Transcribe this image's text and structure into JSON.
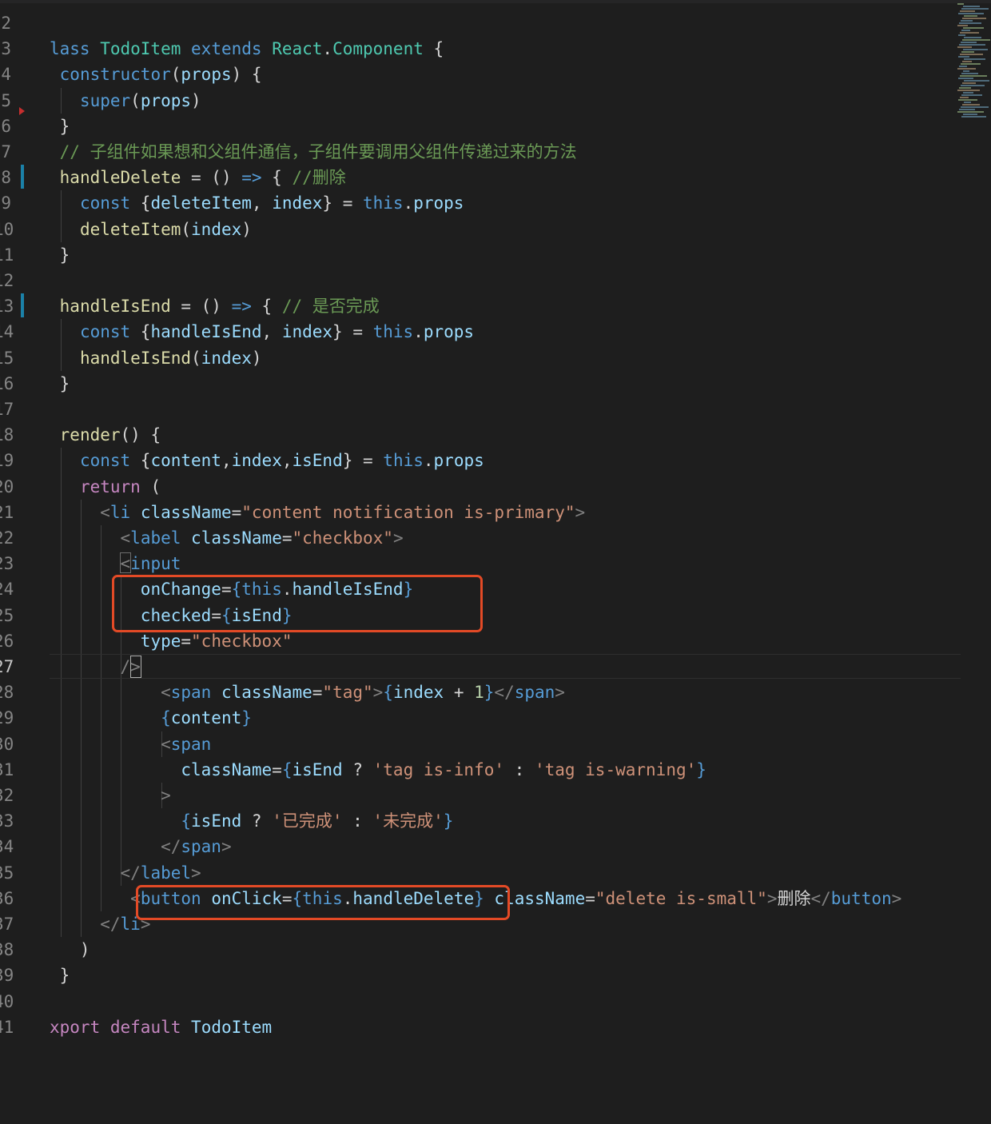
{
  "colors": {
    "background": "#1e1e1e",
    "keyword": "#569cd6",
    "control": "#c586c0",
    "class_name": "#4ec9b0",
    "function_name": "#dcdcaa",
    "variable": "#9cdcfe",
    "string": "#ce9178",
    "comment": "#6a9955",
    "number": "#b5cea8",
    "plain": "#d4d4d4",
    "tag_punct": "#808080",
    "highlight_annotation": "#e34a26"
  },
  "editor": {
    "line_numbers": [
      "2",
      "3",
      "4",
      "5",
      "6",
      "7",
      "8",
      "9",
      "10",
      "11",
      "12",
      "13",
      "14",
      "15",
      "16",
      "17",
      "18",
      "19",
      "20",
      "21",
      "22",
      "23",
      "24",
      "25",
      "26",
      "27",
      "28",
      "29",
      "30",
      "31",
      "32",
      "33",
      "34",
      "35",
      "36",
      "37",
      "38",
      "39",
      "40",
      "41"
    ],
    "active_line": "27",
    "modified_lines": [
      "8",
      "13"
    ],
    "lines": [
      {
        "n": "2",
        "tokens": []
      },
      {
        "n": "3",
        "tokens": [
          {
            "t": "lass ",
            "c": "keyword"
          },
          {
            "t": "TodoItem",
            "c": "class_name"
          },
          {
            "t": " ",
            "c": "plain"
          },
          {
            "t": "extends",
            "c": "keyword"
          },
          {
            "t": " ",
            "c": "plain"
          },
          {
            "t": "React",
            "c": "class_name"
          },
          {
            "t": ".",
            "c": "plain"
          },
          {
            "t": "Component",
            "c": "class_name"
          },
          {
            "t": " {",
            "c": "plain"
          }
        ]
      },
      {
        "n": "4",
        "tokens": [
          {
            "t": " ",
            "c": "plain"
          },
          {
            "t": "constructor",
            "c": "keyword"
          },
          {
            "t": "(",
            "c": "plain"
          },
          {
            "t": "props",
            "c": "variable"
          },
          {
            "t": ") {",
            "c": "plain"
          }
        ]
      },
      {
        "n": "5",
        "tokens": [
          {
            "t": "   ",
            "c": "plain"
          },
          {
            "t": "super",
            "c": "keyword"
          },
          {
            "t": "(",
            "c": "plain"
          },
          {
            "t": "props",
            "c": "variable"
          },
          {
            "t": ")",
            "c": "plain"
          }
        ]
      },
      {
        "n": "6",
        "tokens": [
          {
            "t": " }",
            "c": "plain"
          }
        ]
      },
      {
        "n": "7",
        "tokens": [
          {
            "t": " // 子组件如果想和父组件通信，子组件要调用父组件传递过来的方法",
            "c": "comment"
          }
        ]
      },
      {
        "n": "8",
        "tokens": [
          {
            "t": " ",
            "c": "plain"
          },
          {
            "t": "handleDelete",
            "c": "function_name"
          },
          {
            "t": " = () ",
            "c": "plain"
          },
          {
            "t": "=>",
            "c": "keyword"
          },
          {
            "t": " { ",
            "c": "plain"
          },
          {
            "t": "//删除",
            "c": "comment"
          }
        ]
      },
      {
        "n": "9",
        "tokens": [
          {
            "t": "   ",
            "c": "plain"
          },
          {
            "t": "const",
            "c": "keyword"
          },
          {
            "t": " {",
            "c": "plain"
          },
          {
            "t": "deleteItem",
            "c": "variable"
          },
          {
            "t": ", ",
            "c": "plain"
          },
          {
            "t": "index",
            "c": "variable"
          },
          {
            "t": "} = ",
            "c": "plain"
          },
          {
            "t": "this",
            "c": "keyword"
          },
          {
            "t": ".",
            "c": "plain"
          },
          {
            "t": "props",
            "c": "variable"
          }
        ]
      },
      {
        "n": "10",
        "tokens": [
          {
            "t": "   ",
            "c": "plain"
          },
          {
            "t": "deleteItem",
            "c": "function_name"
          },
          {
            "t": "(",
            "c": "plain"
          },
          {
            "t": "index",
            "c": "variable"
          },
          {
            "t": ")",
            "c": "plain"
          }
        ]
      },
      {
        "n": "11",
        "tokens": [
          {
            "t": " }",
            "c": "plain"
          }
        ]
      },
      {
        "n": "12",
        "tokens": []
      },
      {
        "n": "13",
        "tokens": [
          {
            "t": " ",
            "c": "plain"
          },
          {
            "t": "handleIsEnd",
            "c": "function_name"
          },
          {
            "t": " = () ",
            "c": "plain"
          },
          {
            "t": "=>",
            "c": "keyword"
          },
          {
            "t": " { ",
            "c": "plain"
          },
          {
            "t": "// 是否完成",
            "c": "comment"
          }
        ]
      },
      {
        "n": "14",
        "tokens": [
          {
            "t": "   ",
            "c": "plain"
          },
          {
            "t": "const",
            "c": "keyword"
          },
          {
            "t": " {",
            "c": "plain"
          },
          {
            "t": "handleIsEnd",
            "c": "variable"
          },
          {
            "t": ", ",
            "c": "plain"
          },
          {
            "t": "index",
            "c": "variable"
          },
          {
            "t": "} = ",
            "c": "plain"
          },
          {
            "t": "this",
            "c": "keyword"
          },
          {
            "t": ".",
            "c": "plain"
          },
          {
            "t": "props",
            "c": "variable"
          }
        ]
      },
      {
        "n": "15",
        "tokens": [
          {
            "t": "   ",
            "c": "plain"
          },
          {
            "t": "handleIsEnd",
            "c": "function_name"
          },
          {
            "t": "(",
            "c": "plain"
          },
          {
            "t": "index",
            "c": "variable"
          },
          {
            "t": ")",
            "c": "plain"
          }
        ]
      },
      {
        "n": "16",
        "tokens": [
          {
            "t": " }",
            "c": "plain"
          }
        ]
      },
      {
        "n": "17",
        "tokens": []
      },
      {
        "n": "18",
        "tokens": [
          {
            "t": " ",
            "c": "plain"
          },
          {
            "t": "render",
            "c": "function_name"
          },
          {
            "t": "() {",
            "c": "plain"
          }
        ]
      },
      {
        "n": "19",
        "tokens": [
          {
            "t": "   ",
            "c": "plain"
          },
          {
            "t": "const",
            "c": "keyword"
          },
          {
            "t": " {",
            "c": "plain"
          },
          {
            "t": "content",
            "c": "variable"
          },
          {
            "t": ",",
            "c": "plain"
          },
          {
            "t": "index",
            "c": "variable"
          },
          {
            "t": ",",
            "c": "plain"
          },
          {
            "t": "isEnd",
            "c": "variable"
          },
          {
            "t": "} = ",
            "c": "plain"
          },
          {
            "t": "this",
            "c": "keyword"
          },
          {
            "t": ".",
            "c": "plain"
          },
          {
            "t": "props",
            "c": "variable"
          }
        ]
      },
      {
        "n": "20",
        "tokens": [
          {
            "t": "   ",
            "c": "plain"
          },
          {
            "t": "return",
            "c": "control"
          },
          {
            "t": " (",
            "c": "plain"
          }
        ]
      },
      {
        "n": "21",
        "tokens": [
          {
            "t": "     ",
            "c": "plain"
          },
          {
            "t": "<",
            "c": "tag_punct"
          },
          {
            "t": "li",
            "c": "keyword"
          },
          {
            "t": " ",
            "c": "plain"
          },
          {
            "t": "className",
            "c": "variable"
          },
          {
            "t": "=",
            "c": "plain"
          },
          {
            "t": "\"content notification is-primary\"",
            "c": "string"
          },
          {
            "t": ">",
            "c": "tag_punct"
          }
        ]
      },
      {
        "n": "22",
        "tokens": [
          {
            "t": "       ",
            "c": "plain"
          },
          {
            "t": "<",
            "c": "tag_punct"
          },
          {
            "t": "label",
            "c": "keyword"
          },
          {
            "t": " ",
            "c": "plain"
          },
          {
            "t": "className",
            "c": "variable"
          },
          {
            "t": "=",
            "c": "plain"
          },
          {
            "t": "\"checkbox\"",
            "c": "string"
          },
          {
            "t": ">",
            "c": "tag_punct"
          }
        ]
      },
      {
        "n": "23",
        "tokens": [
          {
            "t": "       ",
            "c": "plain"
          },
          {
            "t": "<",
            "c": "tag_punct"
          },
          {
            "t": "input",
            "c": "keyword"
          }
        ]
      },
      {
        "n": "24",
        "tokens": [
          {
            "t": "         ",
            "c": "plain"
          },
          {
            "t": "onChange",
            "c": "variable"
          },
          {
            "t": "=",
            "c": "plain"
          },
          {
            "t": "{",
            "c": "keyword"
          },
          {
            "t": "this",
            "c": "keyword"
          },
          {
            "t": ".",
            "c": "plain"
          },
          {
            "t": "handleIsEnd",
            "c": "variable"
          },
          {
            "t": "}",
            "c": "keyword"
          }
        ]
      },
      {
        "n": "25",
        "tokens": [
          {
            "t": "         ",
            "c": "plain"
          },
          {
            "t": "checked",
            "c": "variable"
          },
          {
            "t": "=",
            "c": "plain"
          },
          {
            "t": "{",
            "c": "keyword"
          },
          {
            "t": "isEnd",
            "c": "variable"
          },
          {
            "t": "}",
            "c": "keyword"
          }
        ]
      },
      {
        "n": "26",
        "tokens": [
          {
            "t": "         ",
            "c": "plain"
          },
          {
            "t": "type",
            "c": "variable"
          },
          {
            "t": "=",
            "c": "plain"
          },
          {
            "t": "\"checkbox\"",
            "c": "string"
          }
        ]
      },
      {
        "n": "27",
        "tokens": [
          {
            "t": "       ",
            "c": "plain"
          },
          {
            "t": "/>",
            "c": "tag_punct"
          }
        ]
      },
      {
        "n": "28",
        "tokens": [
          {
            "t": "           ",
            "c": "plain"
          },
          {
            "t": "<",
            "c": "tag_punct"
          },
          {
            "t": "span",
            "c": "keyword"
          },
          {
            "t": " ",
            "c": "plain"
          },
          {
            "t": "className",
            "c": "variable"
          },
          {
            "t": "=",
            "c": "plain"
          },
          {
            "t": "\"tag\"",
            "c": "string"
          },
          {
            "t": ">",
            "c": "tag_punct"
          },
          {
            "t": "{",
            "c": "keyword"
          },
          {
            "t": "index",
            "c": "variable"
          },
          {
            "t": " + ",
            "c": "plain"
          },
          {
            "t": "1",
            "c": "number"
          },
          {
            "t": "}",
            "c": "keyword"
          },
          {
            "t": "</",
            "c": "tag_punct"
          },
          {
            "t": "span",
            "c": "keyword"
          },
          {
            "t": ">",
            "c": "tag_punct"
          }
        ]
      },
      {
        "n": "29",
        "tokens": [
          {
            "t": "           ",
            "c": "plain"
          },
          {
            "t": "{",
            "c": "keyword"
          },
          {
            "t": "content",
            "c": "variable"
          },
          {
            "t": "}",
            "c": "keyword"
          }
        ]
      },
      {
        "n": "30",
        "tokens": [
          {
            "t": "           ",
            "c": "plain"
          },
          {
            "t": "<",
            "c": "tag_punct"
          },
          {
            "t": "span",
            "c": "keyword"
          }
        ]
      },
      {
        "n": "31",
        "tokens": [
          {
            "t": "             ",
            "c": "plain"
          },
          {
            "t": "className",
            "c": "variable"
          },
          {
            "t": "=",
            "c": "plain"
          },
          {
            "t": "{",
            "c": "keyword"
          },
          {
            "t": "isEnd",
            "c": "variable"
          },
          {
            "t": " ? ",
            "c": "plain"
          },
          {
            "t": "'tag is-info'",
            "c": "string"
          },
          {
            "t": " : ",
            "c": "plain"
          },
          {
            "t": "'tag is-warning'",
            "c": "string"
          },
          {
            "t": "}",
            "c": "keyword"
          }
        ]
      },
      {
        "n": "32",
        "tokens": [
          {
            "t": "           ",
            "c": "plain"
          },
          {
            "t": ">",
            "c": "tag_punct"
          }
        ]
      },
      {
        "n": "33",
        "tokens": [
          {
            "t": "             ",
            "c": "plain"
          },
          {
            "t": "{",
            "c": "keyword"
          },
          {
            "t": "isEnd",
            "c": "variable"
          },
          {
            "t": " ? ",
            "c": "plain"
          },
          {
            "t": "'已完成'",
            "c": "string"
          },
          {
            "t": " : ",
            "c": "plain"
          },
          {
            "t": "'未完成'",
            "c": "string"
          },
          {
            "t": "}",
            "c": "keyword"
          }
        ]
      },
      {
        "n": "34",
        "tokens": [
          {
            "t": "           ",
            "c": "plain"
          },
          {
            "t": "</",
            "c": "tag_punct"
          },
          {
            "t": "span",
            "c": "keyword"
          },
          {
            "t": ">",
            "c": "tag_punct"
          }
        ]
      },
      {
        "n": "35",
        "tokens": [
          {
            "t": "       ",
            "c": "plain"
          },
          {
            "t": "</",
            "c": "tag_punct"
          },
          {
            "t": "label",
            "c": "keyword"
          },
          {
            "t": ">",
            "c": "tag_punct"
          }
        ]
      },
      {
        "n": "36",
        "tokens": [
          {
            "t": "        ",
            "c": "plain"
          },
          {
            "t": "<",
            "c": "tag_punct"
          },
          {
            "t": "button",
            "c": "keyword"
          },
          {
            "t": " ",
            "c": "plain"
          },
          {
            "t": "onClick",
            "c": "variable"
          },
          {
            "t": "=",
            "c": "plain"
          },
          {
            "t": "{",
            "c": "keyword"
          },
          {
            "t": "this",
            "c": "keyword"
          },
          {
            "t": ".",
            "c": "plain"
          },
          {
            "t": "handleDelete",
            "c": "variable"
          },
          {
            "t": "}",
            "c": "keyword"
          },
          {
            "t": " ",
            "c": "plain"
          },
          {
            "t": "className",
            "c": "variable"
          },
          {
            "t": "=",
            "c": "plain"
          },
          {
            "t": "\"delete is-small\"",
            "c": "string"
          },
          {
            "t": ">",
            "c": "tag_punct"
          },
          {
            "t": "删除",
            "c": "plain"
          },
          {
            "t": "</",
            "c": "tag_punct"
          },
          {
            "t": "button",
            "c": "keyword"
          },
          {
            "t": ">",
            "c": "tag_punct"
          }
        ]
      },
      {
        "n": "37",
        "tokens": [
          {
            "t": "     ",
            "c": "plain"
          },
          {
            "t": "</",
            "c": "tag_punct"
          },
          {
            "t": "li",
            "c": "keyword"
          },
          {
            "t": ">",
            "c": "tag_punct"
          }
        ]
      },
      {
        "n": "38",
        "tokens": [
          {
            "t": "   )",
            "c": "plain"
          }
        ]
      },
      {
        "n": "39",
        "tokens": [
          {
            "t": " }",
            "c": "plain"
          }
        ]
      },
      {
        "n": "40",
        "tokens": []
      },
      {
        "n": "41",
        "tokens": [
          {
            "t": "xport",
            "c": "control"
          },
          {
            "t": " ",
            "c": "plain"
          },
          {
            "t": "default",
            "c": "control"
          },
          {
            "t": " ",
            "c": "plain"
          },
          {
            "t": "TodoItem",
            "c": "variable"
          }
        ]
      }
    ]
  }
}
